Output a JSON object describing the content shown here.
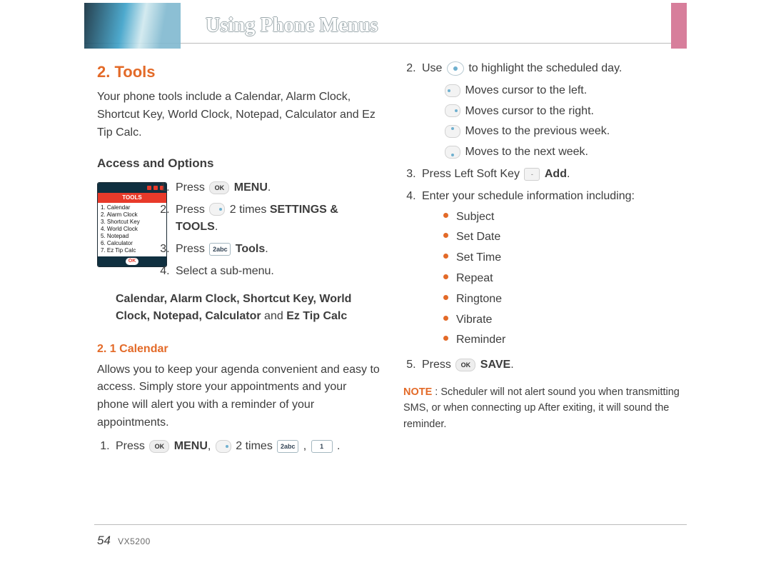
{
  "header": {
    "title": "Using Phone Menus"
  },
  "section": {
    "number_title": "2. Tools",
    "intro": "Your phone tools include a Calendar, Alarm Clock, Shortcut Key, World Clock, Notepad, Calculator and Ez Tip Calc."
  },
  "access": {
    "heading": "Access and Options",
    "thumb_title": "TOOLS",
    "thumb_items": [
      "1. Calendar",
      "2. Alarm Clock",
      "3. Shortcut Key",
      "4. World Clock",
      "5. Notepad",
      "6. Calculator",
      "7. Ez Tip Calc"
    ],
    "thumb_ok": "OK",
    "step1_a": "Press ",
    "step1_b": "MENU",
    "step1_c": ".",
    "step2_a": "Press ",
    "step2_b": " 2 times ",
    "step2_c": "SETTINGS & TOOLS",
    "step2_d": ".",
    "step3_a": "Press ",
    "step3_key": "2abc",
    "step3_b": "Tools",
    "step3_c": ".",
    "step4": "Select a sub-menu.",
    "tool_list_a": "Calendar, Alarm Clock, Shortcut Key, World Clock, Notepad, Calculator",
    "tool_list_and": " and ",
    "tool_list_b": "Ez Tip Calc"
  },
  "calendar": {
    "heading": "2. 1 Calendar",
    "body": "Allows you to keep your agenda convenient and easy to access. Simply store your appointments and your phone will alert you with a reminder of your appointments.",
    "step1_a": "Press ",
    "step1_b": "MENU",
    "step1_c": ", ",
    "step1_d": " 2 times ",
    "step1_key2": "2abc",
    "step1_e": " , ",
    "step1_key1": "1",
    "step1_f": " ."
  },
  "right": {
    "step2_a": "Use ",
    "step2_b": " to highlight the scheduled day.",
    "arrows": {
      "left": "Moves cursor to the left.",
      "right": "Moves cursor to the right.",
      "up": "Moves to the previous week.",
      "down": "Moves to the next week."
    },
    "step3_a": "Press Left Soft Key ",
    "step3_soft": "-",
    "step3_b": "Add",
    "step3_c": ".",
    "step4": "Enter your schedule information including:",
    "bullets": [
      "Subject",
      "Set Date",
      "Set Time",
      "Repeat",
      "Ringtone",
      "Vibrate",
      "Reminder"
    ],
    "step5_a": "Press ",
    "step5_b": "SAVE",
    "step5_c": ".",
    "note_label": "NOTE",
    "note_body": " : Scheduler will not alert sound you when transmitting SMS, or when connecting up After exiting, it will sound the reminder."
  },
  "footer": {
    "page": "54",
    "model": "VX5200"
  },
  "keys": {
    "ok": "OK"
  }
}
